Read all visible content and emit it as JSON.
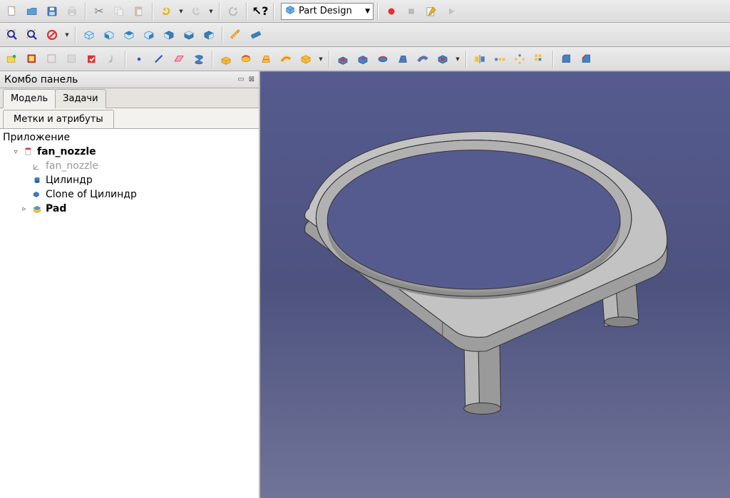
{
  "workbench": "Part Design",
  "panel": {
    "title": "Комбо панель",
    "tab_model": "Модель",
    "tab_tasks": "Задачи",
    "subtab_labels": "Метки и атрибуты"
  },
  "tree": {
    "root": "Приложение",
    "doc": "fan_nozzle",
    "items": [
      {
        "label": "fan_nozzle",
        "style": "grey"
      },
      {
        "label": "Цилиндр",
        "style": "norm"
      },
      {
        "label": "Clone of Цилиндр",
        "style": "norm"
      },
      {
        "label": "Pad",
        "style": "bold"
      }
    ]
  }
}
